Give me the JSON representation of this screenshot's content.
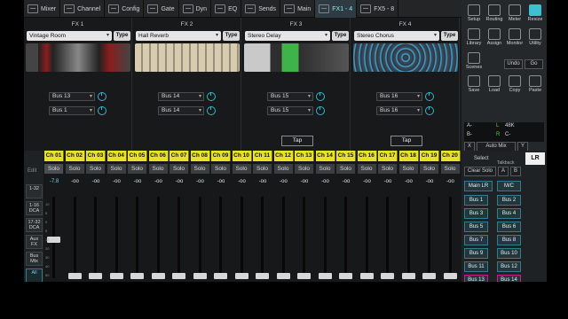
{
  "topnav": {
    "tabs": [
      {
        "label": "Mixer",
        "icon": "mixer-icon"
      },
      {
        "label": "Channel",
        "icon": "channel-icon"
      },
      {
        "label": "Config",
        "icon": "config-icon"
      },
      {
        "label": "Gate",
        "icon": "gate-icon"
      },
      {
        "label": "Dyn",
        "icon": "dyn-icon"
      },
      {
        "label": "EQ",
        "icon": "eq-icon"
      },
      {
        "label": "Sends",
        "icon": "sends-icon"
      },
      {
        "label": "Main",
        "icon": "main-icon"
      },
      {
        "label": "FX1 - 4",
        "icon": "fx-icon"
      },
      {
        "label": "FX5 - 8",
        "icon": "fx-icon"
      }
    ],
    "active": "FX1 - 4"
  },
  "fx": [
    {
      "title": "FX 1",
      "preset": "Vintage Room",
      "type_label": "Type",
      "bus_a": "Bus 13",
      "bus_b": "Bus 1",
      "tap": ""
    },
    {
      "title": "FX 2",
      "preset": "Hall Reverb",
      "type_label": "Type",
      "bus_a": "Bus 14",
      "bus_b": "Bus 14",
      "tap": ""
    },
    {
      "title": "FX 3",
      "preset": "Stereo Delay",
      "type_label": "Type",
      "bus_a": "Bus 15",
      "bus_b": "Bus 15",
      "tap": "Tap"
    },
    {
      "title": "FX 4",
      "preset": "Stereo Chorus",
      "type_label": "Type",
      "bus_a": "Bus 16",
      "bus_b": "Bus 16",
      "tap": "Tap"
    }
  ],
  "right": {
    "buttons": [
      "Setup",
      "Routing",
      "Meter",
      "Resize",
      "Library",
      "Assign",
      "Monitor",
      "Utility",
      "Scenes",
      "Save",
      "Load",
      "Copy",
      "Paste"
    ],
    "undo": "Undo",
    "go": "Go",
    "meters": {
      "a": "A-",
      "b": "B-",
      "l": "L",
      "r": "R",
      "rate": "48K",
      "c": "C-"
    },
    "x": "X",
    "automix": "Auto Mix",
    "y": "Y"
  },
  "leftnav": {
    "edit": "Edit",
    "items": [
      "1-32",
      "1-16 DCA",
      "17-32 DCA",
      "Aux FX",
      "Bus Mtx",
      "All"
    ]
  },
  "channels": {
    "names": [
      "Ch 01",
      "Ch 02",
      "Ch 03",
      "Ch 04",
      "Ch 05",
      "Ch 06",
      "Ch 07",
      "Ch 08",
      "Ch 09",
      "Ch 10",
      "Ch 11",
      "Ch 12",
      "Ch 13",
      "Ch 14",
      "Ch 15",
      "Ch 16",
      "Ch 17",
      "Ch 18",
      "Ch 19",
      "Ch 20"
    ],
    "solo": "Solo",
    "gains": [
      "-7.8",
      "-oo",
      "-oo",
      "-oo",
      "-oo",
      "-oo",
      "-oo",
      "-oo",
      "-oo",
      "-oo",
      "-oo",
      "-oo",
      "-oo",
      "-oo",
      "-oo",
      "-oo",
      "-oo",
      "-oo",
      "-oo",
      "-oo"
    ],
    "ticks": [
      "10",
      "5",
      "0",
      "5",
      "10",
      "20",
      "30",
      "40",
      "50"
    ]
  },
  "bottomright": {
    "select": "Select",
    "talkback": "Talkback",
    "clear_solo": "Clear Solo",
    "a": "A",
    "b": "B",
    "main_lr": "Main LR",
    "mc": "M/C",
    "lr": "LR",
    "buses": [
      "Bus 1",
      "Bus 2",
      "Bus 3",
      "Bus 4",
      "Bus 5",
      "Bus 6",
      "Bus 7",
      "Bus 8",
      "Bus 9",
      "Bus 10",
      "Bus 11",
      "Bus 12",
      "Bus 13",
      "Bus 14"
    ]
  }
}
